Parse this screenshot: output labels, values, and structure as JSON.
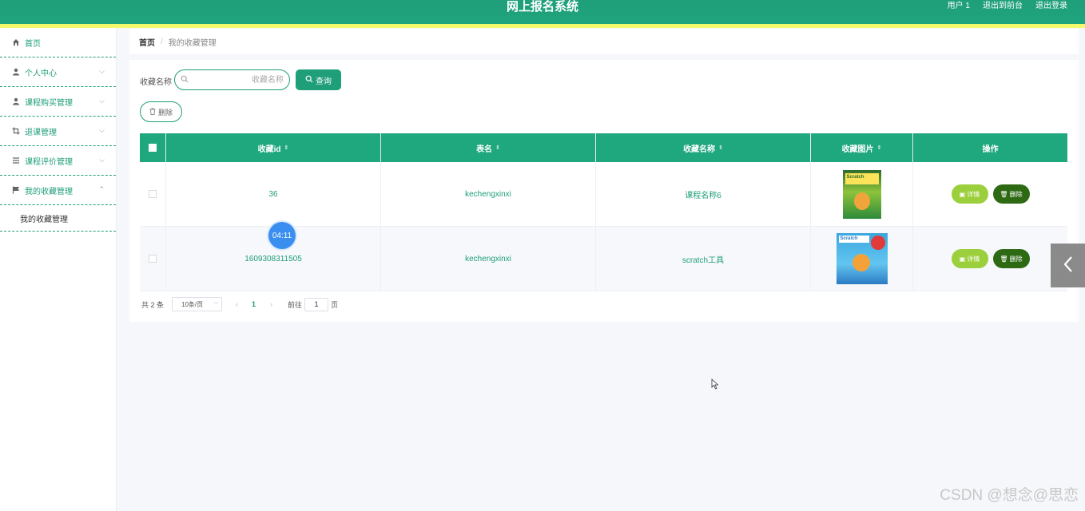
{
  "header": {
    "title": "网上报名系统",
    "user": "用户 1",
    "frontend_link": "退出到前台",
    "logout": "退出登录"
  },
  "sidebar": {
    "items": [
      {
        "label": "首页",
        "icon": "home-icon"
      },
      {
        "label": "个人中心",
        "icon": "user-icon"
      },
      {
        "label": "课程购买管理",
        "icon": "user-icon"
      },
      {
        "label": "退课管理",
        "icon": "crop-icon"
      },
      {
        "label": "课程评价管理",
        "icon": "list-icon"
      },
      {
        "label": "我的收藏管理",
        "icon": "flag-icon"
      }
    ],
    "submenu": [
      "我的收藏管理"
    ]
  },
  "breadcrumb": {
    "home": "首页",
    "separator": "/",
    "current": "我的收藏管理"
  },
  "search": {
    "label": "收藏名称",
    "placeholder": "收藏名称",
    "button": "查询"
  },
  "toolbar": {
    "delete_label": "删除"
  },
  "table": {
    "columns": [
      "收藏id",
      "表名",
      "收藏名称",
      "收藏图片",
      "操作"
    ],
    "rows": [
      {
        "id": "36",
        "table": "kechengxinxi",
        "name": "课程名称6",
        "image": "Scratch"
      },
      {
        "id": "1609308311505",
        "table": "kechengxinxi",
        "name": "scratch工具",
        "image": "Scratch"
      }
    ],
    "detail_label": "详情",
    "delete_label": "删除"
  },
  "pagination": {
    "total": "共 2 条",
    "page_size": "10条/页",
    "current_page": "1",
    "goto_label": "前往",
    "goto_value": "1",
    "page_suffix": "页"
  },
  "timer": "04:11",
  "watermark": "CSDN @想念@思恋",
  "colors": {
    "primary": "#1f9e7a",
    "accent_yellow": "#f3f96a",
    "detail": "#9ccf3c",
    "delete": "#2e6a14"
  }
}
